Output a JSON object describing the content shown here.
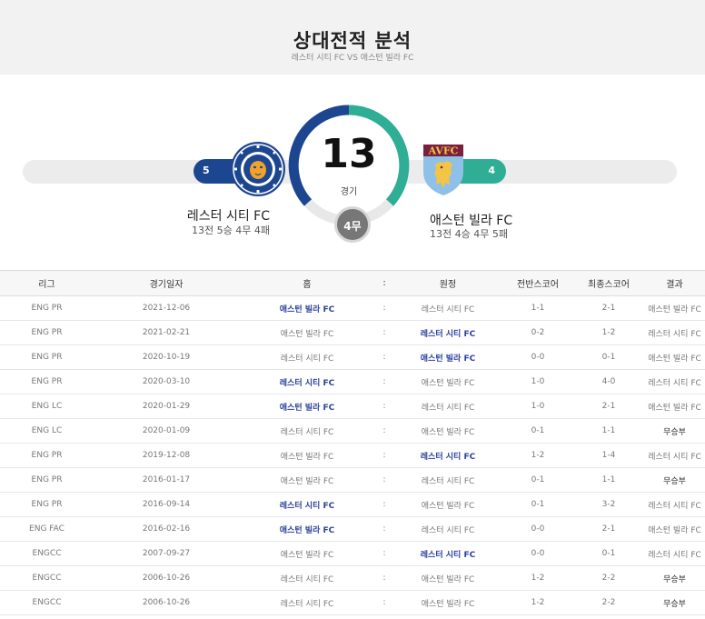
{
  "header": {
    "title": "상대전적 분석",
    "subtitle": "레스터 시티 FC VS 애스턴 빌라 FC"
  },
  "summary": {
    "total": "13",
    "total_label": "경기",
    "draws": "4무",
    "home_wins": "5",
    "away_wins": "4",
    "home_team": {
      "name": "레스터 시티 FC",
      "record": "13전 5승 4무 4패"
    },
    "away_team": {
      "name": "애스턴 빌라 FC",
      "record": "13전 4승 4무 5패",
      "crest_text": "AVFC"
    },
    "colors": {
      "home": "#1d4690",
      "away": "#2fae95",
      "draw": "#777777"
    }
  },
  "table": {
    "columns": [
      "리그",
      "경기일자",
      "홈",
      ":",
      "원정",
      "전반스코어",
      "최종스코어",
      "결과"
    ],
    "rows": [
      {
        "league": "ENG PR",
        "date": "2021-12-06",
        "home": "애스턴 빌라 FC",
        "sep": ":",
        "away": "레스터 시티 FC",
        "half": "1-1",
        "final": "2-1",
        "result": "애스턴 빌라 FC",
        "winner": "home"
      },
      {
        "league": "ENG PR",
        "date": "2021-02-21",
        "home": "애스턴 빌라 FC",
        "sep": ":",
        "away": "레스터 시티 FC",
        "half": "0-2",
        "final": "1-2",
        "result": "레스터 시티 FC",
        "winner": "away"
      },
      {
        "league": "ENG PR",
        "date": "2020-10-19",
        "home": "레스터 시티 FC",
        "sep": ":",
        "away": "애스턴 빌라 FC",
        "half": "0-0",
        "final": "0-1",
        "result": "애스턴 빌라 FC",
        "winner": "away"
      },
      {
        "league": "ENG PR",
        "date": "2020-03-10",
        "home": "레스터 시티 FC",
        "sep": ":",
        "away": "애스턴 빌라 FC",
        "half": "1-0",
        "final": "4-0",
        "result": "레스터 시티 FC",
        "winner": "home"
      },
      {
        "league": "ENG LC",
        "date": "2020-01-29",
        "home": "애스턴 빌라 FC",
        "sep": ":",
        "away": "레스터 시티 FC",
        "half": "1-0",
        "final": "2-1",
        "result": "애스턴 빌라 FC",
        "winner": "home"
      },
      {
        "league": "ENG LC",
        "date": "2020-01-09",
        "home": "레스터 시티 FC",
        "sep": ":",
        "away": "애스턴 빌라 FC",
        "half": "0-1",
        "final": "1-1",
        "result": "무승부",
        "winner": "draw"
      },
      {
        "league": "ENG PR",
        "date": "2019-12-08",
        "home": "애스턴 빌라 FC",
        "sep": ":",
        "away": "레스터 시티 FC",
        "half": "1-2",
        "final": "1-4",
        "result": "레스터 시티 FC",
        "winner": "away"
      },
      {
        "league": "ENG PR",
        "date": "2016-01-17",
        "home": "애스턴 빌라 FC",
        "sep": ":",
        "away": "레스터 시티 FC",
        "half": "0-1",
        "final": "1-1",
        "result": "무승부",
        "winner": "draw"
      },
      {
        "league": "ENG PR",
        "date": "2016-09-14",
        "home": "레스터 시티 FC",
        "sep": ":",
        "away": "애스턴 빌라 FC",
        "half": "0-1",
        "final": "3-2",
        "result": "레스터 시티 FC",
        "winner": "home"
      },
      {
        "league": "ENG FAC",
        "date": "2016-02-16",
        "home": "애스턴 빌라 FC",
        "sep": ":",
        "away": "레스터 시티 FC",
        "half": "0-0",
        "final": "2-1",
        "result": "애스턴 빌라 FC",
        "winner": "home"
      },
      {
        "league": "ENGCC",
        "date": "2007-09-27",
        "home": "애스턴 빌라 FC",
        "sep": ":",
        "away": "레스터 시티 FC",
        "half": "0-0",
        "final": "0-1",
        "result": "레스터 시티 FC",
        "winner": "away"
      },
      {
        "league": "ENGCC",
        "date": "2006-10-26",
        "home": "레스터 시티 FC",
        "sep": ":",
        "away": "애스턴 빌라 FC",
        "half": "1-2",
        "final": "2-2",
        "result": "무승부",
        "winner": "draw"
      },
      {
        "league": "ENGCC",
        "date": "2006-10-26",
        "home": "레스터 시티 FC",
        "sep": ":",
        "away": "애스턴 빌라 FC",
        "half": "1-2",
        "final": "2-2",
        "result": "무승부",
        "winner": "draw"
      }
    ]
  }
}
